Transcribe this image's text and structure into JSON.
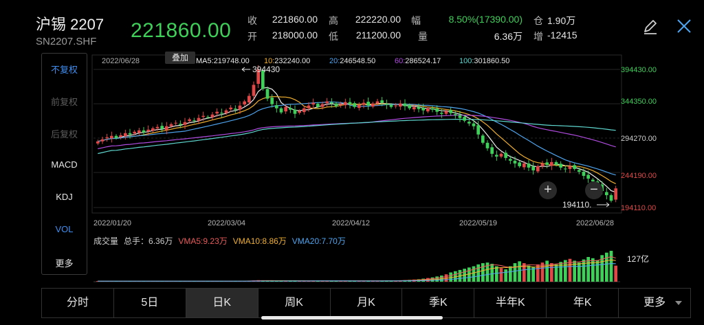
{
  "header": {
    "name": "沪锡 2207",
    "code": "SN2207.SHF",
    "price": "221860.00",
    "quote": [
      {
        "label": "收",
        "value": "221860.00"
      },
      {
        "label": "高",
        "value": "222220.00"
      },
      {
        "label": "幅",
        "value": "8.50%(17390.00)"
      },
      {
        "label": "仓",
        "value": "1.90万"
      },
      {
        "label": "开",
        "value": "218000.00"
      },
      {
        "label": "低",
        "value": "211200.00"
      },
      {
        "label": "量",
        "value": "6.36万"
      },
      {
        "label": "增",
        "value": "-12415"
      }
    ],
    "icons": [
      "edit-icon",
      "close-icon"
    ]
  },
  "sidebar": {
    "items": [
      "不复权",
      "前复权",
      "后复权",
      "MACD",
      "KDJ",
      "VOL",
      "更多"
    ]
  },
  "chart": {
    "date_label": "2022/06/28",
    "overlay_button": "叠加",
    "ma_legend": [
      {
        "label": "MA5:",
        "value": "219748.00",
        "color": "#f0f0f0"
      },
      {
        "label": "10:",
        "value": "232240.00",
        "color": "#f0b030"
      },
      {
        "label": "20:",
        "value": "246548.50",
        "color": "#4ea4ee"
      },
      {
        "label": "60:",
        "value": "286524.17",
        "color": "#b04ce0"
      },
      {
        "label": "100:",
        "value": "301860.50",
        "color": "#5fd8d0"
      }
    ],
    "high_marker": "394430",
    "low_marker": "194110.",
    "y_ticks": [
      "394430.00",
      "344350.00",
      "294270.00",
      "244190.00",
      "194110.00"
    ],
    "y_tick_colors": [
      "#3fd05a",
      "#3fd05a",
      "#cfcfcf",
      "#e04848",
      "#e04848"
    ],
    "x_ticks": [
      "2022/01/20",
      "2022/03/04",
      "2022/04/12",
      "2022/05/19",
      "2022/06/28"
    ],
    "zoom_in": "+",
    "zoom_out": "−",
    "volume_legend": [
      {
        "label": "成交量",
        "color": "#cfcfcf"
      },
      {
        "label": "总手：6.36万",
        "color": "#cfcfcf"
      },
      {
        "label": "VMA5:9.23万",
        "color": "#e85a5a"
      },
      {
        "label": "VMA10:8.86万",
        "color": "#f0b030"
      },
      {
        "label": "VMA20:7.70万",
        "color": "#4ea4ee"
      }
    ],
    "volume_max_label": "127亿",
    "colors": {
      "up": "#e04848",
      "down": "#3fd05a",
      "grid": "#2a2a2a"
    }
  },
  "chart_data": {
    "type": "candlestick",
    "ylim": [
      194110,
      394430
    ],
    "x_ticks": [
      "2022/01/20",
      "2022/03/04",
      "2022/04/12",
      "2022/05/19",
      "2022/06/28"
    ],
    "close": [
      290000,
      293000,
      296000,
      298000,
      295000,
      299000,
      302000,
      300000,
      304000,
      306000,
      303000,
      307000,
      309000,
      311000,
      308000,
      312000,
      315000,
      317000,
      314000,
      318000,
      322000,
      320000,
      324000,
      327000,
      325000,
      329000,
      333000,
      331000,
      335000,
      339000,
      336000,
      342000,
      348000,
      356000,
      372000,
      394430,
      366000,
      352000,
      344000,
      338000,
      332000,
      340000,
      336000,
      330000,
      334000,
      338000,
      342000,
      346000,
      340000,
      344000,
      348000,
      345000,
      341000,
      344000,
      347000,
      344000,
      340000,
      343000,
      346000,
      342000,
      345000,
      348000,
      346000,
      343000,
      340000,
      342000,
      345000,
      341000,
      338000,
      340000,
      337000,
      335000,
      338000,
      336000,
      333000,
      330000,
      334000,
      331000,
      328000,
      324000,
      320000,
      316000,
      312000,
      300000,
      288000,
      280000,
      272000,
      268000,
      272000,
      266000,
      262000,
      258000,
      254000,
      258000,
      252000,
      248000,
      254000,
      258000,
      256000,
      260000,
      256000,
      252000,
      250000,
      254000,
      250000,
      246000,
      240000,
      236000,
      232000,
      226000,
      218000,
      212000,
      204000,
      221860
    ],
    "volume_ratio": [
      0.02,
      0.02,
      0.02,
      0.02,
      0.02,
      0.02,
      0.02,
      0.02,
      0.02,
      0.02,
      0.02,
      0.02,
      0.02,
      0.02,
      0.02,
      0.02,
      0.02,
      0.02,
      0.02,
      0.02,
      0.02,
      0.02,
      0.02,
      0.02,
      0.02,
      0.02,
      0.02,
      0.02,
      0.02,
      0.02,
      0.02,
      0.03,
      0.03,
      0.03,
      0.04,
      0.05,
      0.04,
      0.03,
      0.03,
      0.03,
      0.03,
      0.03,
      0.03,
      0.03,
      0.03,
      0.03,
      0.03,
      0.03,
      0.03,
      0.03,
      0.03,
      0.03,
      0.03,
      0.03,
      0.03,
      0.03,
      0.03,
      0.03,
      0.03,
      0.03,
      0.03,
      0.03,
      0.03,
      0.04,
      0.04,
      0.04,
      0.04,
      0.05,
      0.06,
      0.07,
      0.08,
      0.1,
      0.12,
      0.14,
      0.17,
      0.2,
      0.24,
      0.3,
      0.34,
      0.38,
      0.42,
      0.46,
      0.5,
      0.56,
      0.6,
      0.62,
      0.58,
      0.5,
      0.44,
      0.4,
      0.5,
      0.6,
      0.66,
      0.6,
      0.52,
      0.48,
      0.56,
      0.62,
      0.68,
      0.6,
      0.56,
      0.64,
      0.7,
      0.74,
      0.68,
      0.62,
      0.72,
      0.8,
      0.76,
      0.7,
      0.86,
      0.94,
      1.0,
      0.52
    ]
  },
  "tabs": [
    {
      "label": "分时"
    },
    {
      "label": "5日"
    },
    {
      "label": "日K"
    },
    {
      "label": "周K"
    },
    {
      "label": "月K"
    },
    {
      "label": "季K"
    },
    {
      "label": "半年K"
    },
    {
      "label": "年K"
    },
    {
      "label": "更多"
    }
  ],
  "active_tab": "日K"
}
